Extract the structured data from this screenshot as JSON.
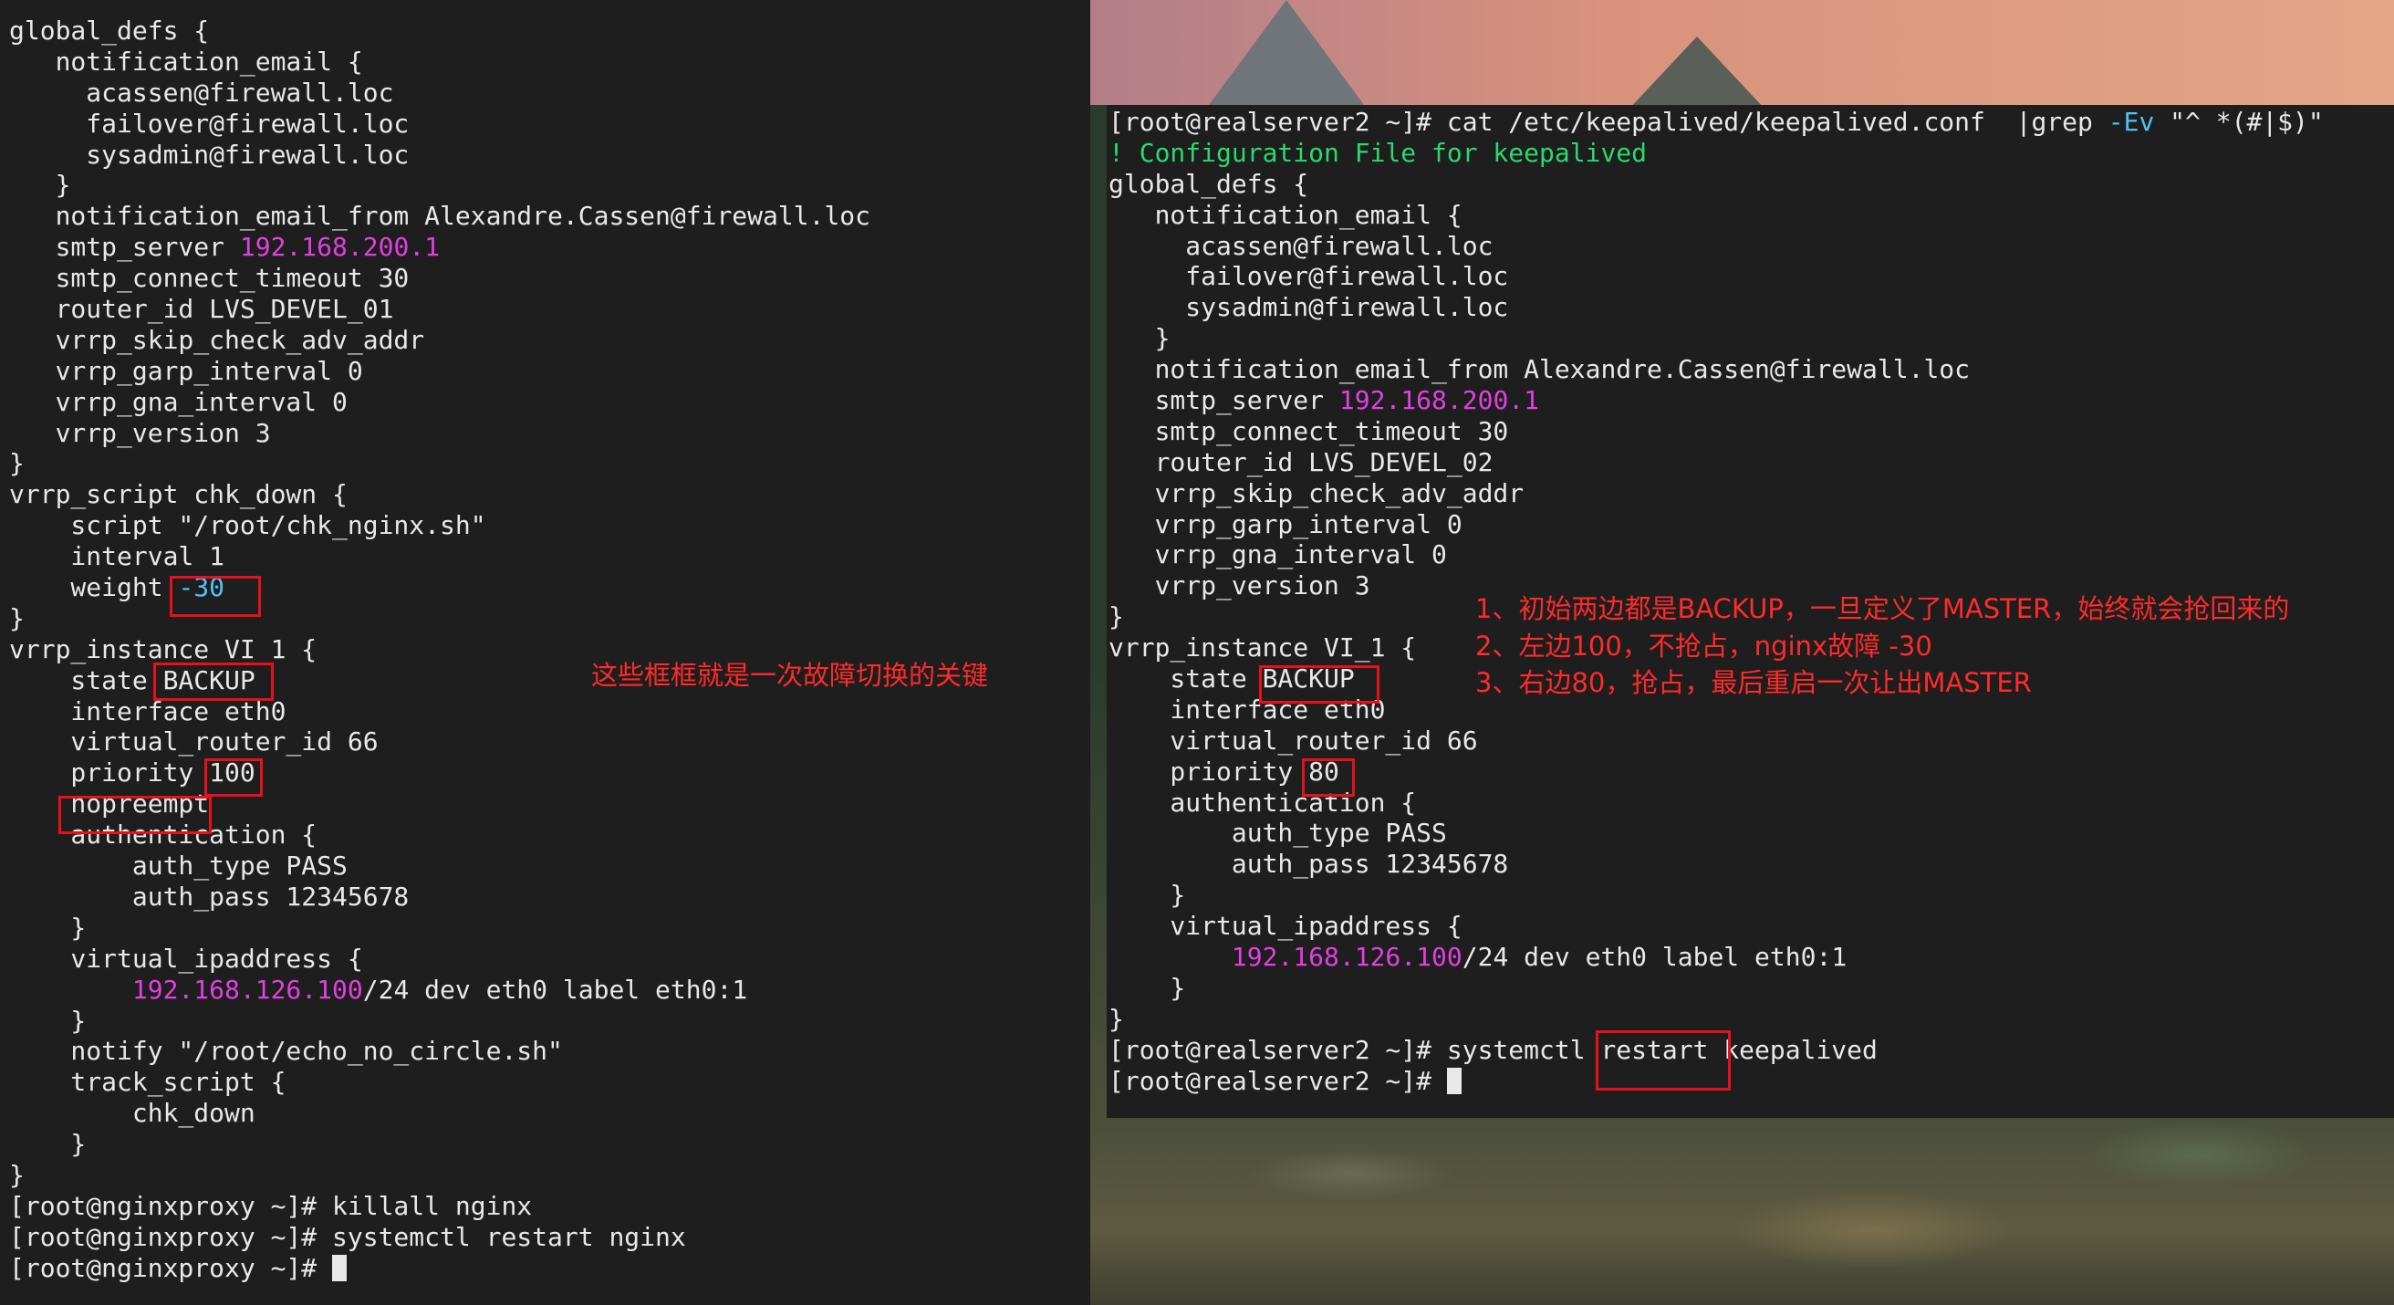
{
  "left_terminal": {
    "lines": [
      [
        {
          "t": "global_defs {"
        }
      ],
      [
        {
          "t": "   notification_email {"
        }
      ],
      [
        {
          "t": "     acassen@firewall.loc"
        }
      ],
      [
        {
          "t": "     failover@firewall.loc"
        }
      ],
      [
        {
          "t": "     sysadmin@firewall.loc"
        }
      ],
      [
        {
          "t": "   }"
        }
      ],
      [
        {
          "t": "   notification_email_from Alexandre.Cassen@firewall.loc"
        }
      ],
      [
        {
          "t": "   smtp_server "
        },
        {
          "t": "192.168.200.1",
          "c": "magenta"
        }
      ],
      [
        {
          "t": "   smtp_connect_timeout 30"
        }
      ],
      [
        {
          "t": "   router_id LVS_DEVEL_01"
        }
      ],
      [
        {
          "t": "   vrrp_skip_check_adv_addr"
        }
      ],
      [
        {
          "t": "   vrrp_garp_interval 0"
        }
      ],
      [
        {
          "t": "   vrrp_gna_interval 0"
        }
      ],
      [
        {
          "t": "   vrrp_version 3"
        }
      ],
      [
        {
          "t": "}"
        }
      ],
      [
        {
          "t": "vrrp_script chk_down {"
        }
      ],
      [
        {
          "t": "    script \"/root/chk_nginx.sh\""
        }
      ],
      [
        {
          "t": "    interval 1"
        }
      ],
      [
        {
          "t": "    weight "
        },
        {
          "t": "-30",
          "c": "cyan"
        }
      ],
      [
        {
          "t": "}"
        }
      ],
      [
        {
          "t": "vrrp_instance VI_1 {"
        }
      ],
      [
        {
          "t": "    state BACKUP"
        }
      ],
      [
        {
          "t": "    interface eth0"
        }
      ],
      [
        {
          "t": "    virtual_router_id 66"
        }
      ],
      [
        {
          "t": "    priority 100"
        }
      ],
      [
        {
          "t": "    nopreempt"
        }
      ],
      [
        {
          "t": "    authentication {"
        }
      ],
      [
        {
          "t": "        auth_type PASS"
        }
      ],
      [
        {
          "t": "        auth_pass 12345678"
        }
      ],
      [
        {
          "t": "    }"
        }
      ],
      [
        {
          "t": "    virtual_ipaddress {"
        }
      ],
      [
        {
          "t": "        "
        },
        {
          "t": "192.168.126.100",
          "c": "magenta"
        },
        {
          "t": "/24 dev eth0 label eth0:1"
        }
      ],
      [
        {
          "t": "    }"
        }
      ],
      [
        {
          "t": "    notify \"/root/echo_no_circle.sh\""
        }
      ],
      [
        {
          "t": "    track_script {"
        }
      ],
      [
        {
          "t": "        chk_down"
        }
      ],
      [
        {
          "t": "    }"
        }
      ],
      [
        {
          "t": "}"
        }
      ],
      [
        {
          "t": "[root@nginxproxy ~]# killall nginx"
        }
      ],
      [
        {
          "t": "[root@nginxproxy ~]# systemctl restart nginx"
        }
      ],
      [
        {
          "t": "[root@nginxproxy ~]# "
        },
        {
          "t": "",
          "cursor": true
        }
      ]
    ]
  },
  "right_terminal": {
    "lines": [
      [
        {
          "t": "[root@realserver2 ~]# cat /etc/keepalived/keepalived.conf  |grep "
        },
        {
          "t": "-Ev",
          "c": "cyan"
        },
        {
          "t": " \"^ *(#|$)\""
        }
      ],
      [
        {
          "t": "! Configuration File for keepalived",
          "c": "green"
        }
      ],
      [
        {
          "t": "global_defs {"
        }
      ],
      [
        {
          "t": "   notification_email {"
        }
      ],
      [
        {
          "t": "     acassen@firewall.loc"
        }
      ],
      [
        {
          "t": "     failover@firewall.loc"
        }
      ],
      [
        {
          "t": "     sysadmin@firewall.loc"
        }
      ],
      [
        {
          "t": "   }"
        }
      ],
      [
        {
          "t": "   notification_email_from Alexandre.Cassen@firewall.loc"
        }
      ],
      [
        {
          "t": "   smtp_server "
        },
        {
          "t": "192.168.200.1",
          "c": "magenta"
        }
      ],
      [
        {
          "t": "   smtp_connect_timeout 30"
        }
      ],
      [
        {
          "t": "   router_id LVS_DEVEL_02"
        }
      ],
      [
        {
          "t": "   vrrp_skip_check_adv_addr"
        }
      ],
      [
        {
          "t": "   vrrp_garp_interval 0"
        }
      ],
      [
        {
          "t": "   vrrp_gna_interval 0"
        }
      ],
      [
        {
          "t": "   vrrp_version 3"
        }
      ],
      [
        {
          "t": "}"
        }
      ],
      [
        {
          "t": "vrrp_instance VI_1 {"
        }
      ],
      [
        {
          "t": "    state BACKUP"
        }
      ],
      [
        {
          "t": "    interface eth0"
        }
      ],
      [
        {
          "t": "    virtual_router_id 66"
        }
      ],
      [
        {
          "t": "    priority 80"
        }
      ],
      [
        {
          "t": "    authentication {"
        }
      ],
      [
        {
          "t": "        auth_type PASS"
        }
      ],
      [
        {
          "t": "        auth_pass 12345678"
        }
      ],
      [
        {
          "t": "    }"
        }
      ],
      [
        {
          "t": "    virtual_ipaddress {"
        }
      ],
      [
        {
          "t": "        "
        },
        {
          "t": "192.168.126.100",
          "c": "magenta"
        },
        {
          "t": "/24 dev eth0 label eth0:1"
        }
      ],
      [
        {
          "t": "    }"
        }
      ],
      [
        {
          "t": "}"
        }
      ],
      [
        {
          "t": "[root@realserver2 ~]# systemctl restart keepalived"
        }
      ],
      [
        {
          "t": "[root@realserver2 ~]# "
        },
        {
          "t": "",
          "cursor": true
        }
      ]
    ]
  },
  "annotations": {
    "left_note": "这些框框就是一次故障切换的关键",
    "right_notes": [
      "1、初始两边都是BACKUP，一旦定义了MASTER，始终就会抢回来的",
      "2、左边100，不抢占，nginx故障 -30",
      "3、右边80，抢占，最后重启一次让出MASTER"
    ]
  },
  "colors": {
    "terminal_bg": "#1e1e1e",
    "terminal_fg": "#e8e8e8",
    "magenta": "#e040e0",
    "cyan": "#4fc3f7",
    "green": "#2bd96b",
    "annotation_red": "#ff2a2a"
  }
}
